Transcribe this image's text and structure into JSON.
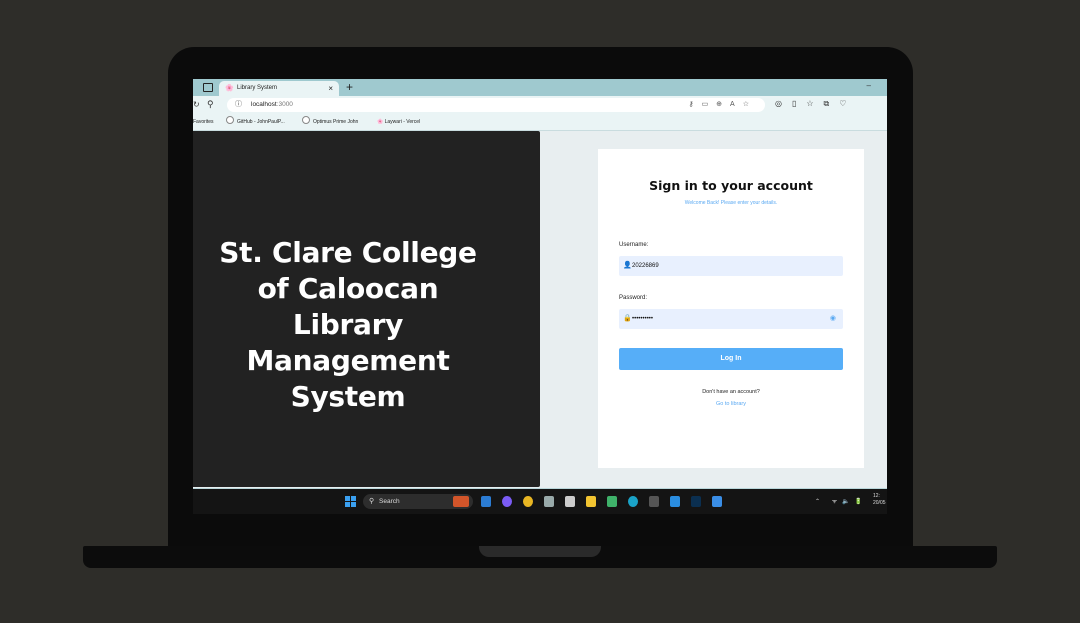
{
  "browser": {
    "tab_title": "Library System",
    "tab_close": "×",
    "new_tab": "+",
    "minimize": "–",
    "url_host": "localhost",
    "url_port": ":3000",
    "favorites_label": "Favorites",
    "bookmarks": [
      {
        "label": "GitHub - JohnPaulP..."
      },
      {
        "label": "Optimus Prime John"
      },
      {
        "label": "Laywari - Vercel"
      }
    ]
  },
  "hero": {
    "line1": "St. Clare College",
    "line2": "of Caloocan",
    "line3": "Library Management",
    "line4": "System"
  },
  "login": {
    "title": "Sign in to your account",
    "subtitle": "Welcome Back! Please enter your details.",
    "username_label": "Username:",
    "username_value": "20226869",
    "password_label": "Password:",
    "password_value": "••••••••••",
    "login_button": "Log In",
    "no_account": "Don't have an account?",
    "go_library": "Go to library"
  },
  "taskbar": {
    "search_label": "Search",
    "time": "12:",
    "date": "20/05"
  },
  "colors": {
    "accent": "#56aef8",
    "link": "#5aa9f2",
    "hero_bg": "#222222",
    "tabbar": "#9fc9cf"
  }
}
